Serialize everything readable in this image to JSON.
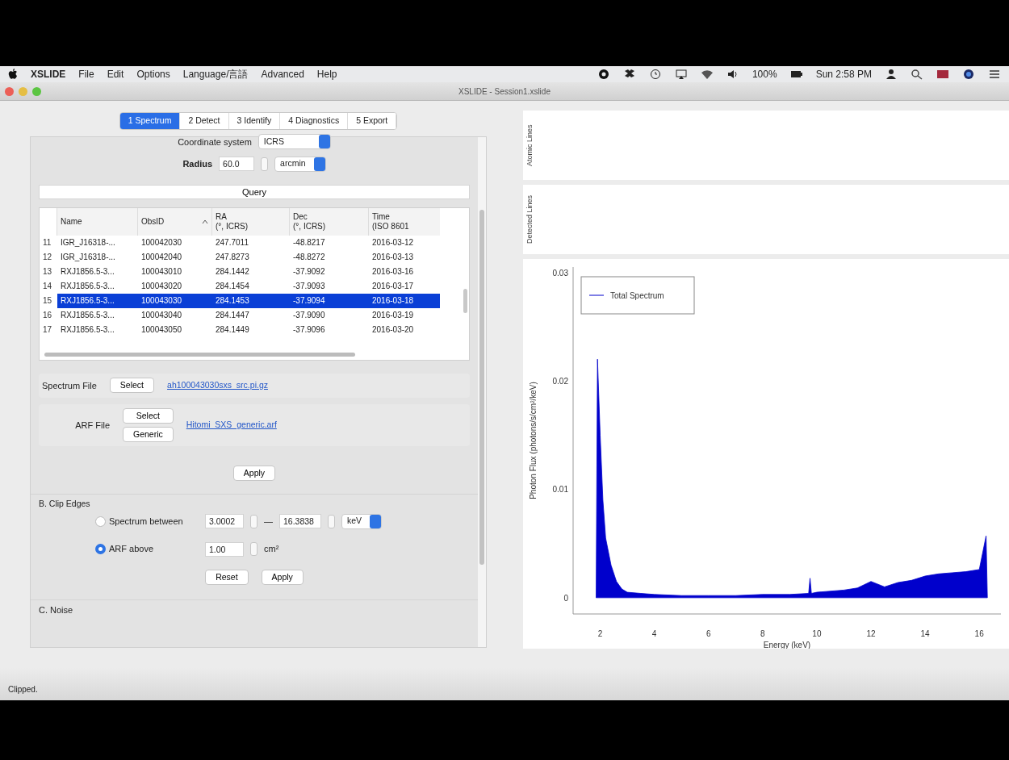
{
  "menubar": {
    "app": "XSLIDE",
    "menus": [
      "File",
      "Edit",
      "Options",
      "Language/言語",
      "Advanced",
      "Help"
    ],
    "battery": "100%",
    "clock": "Sun 2:58 PM"
  },
  "window": {
    "title": "XSLIDE - Session1.xslide"
  },
  "tabs": [
    {
      "label": "1 Spectrum",
      "selected": true
    },
    {
      "label": "2 Detect",
      "selected": false
    },
    {
      "label": "3 Identify",
      "selected": false
    },
    {
      "label": "4 Diagnostics",
      "selected": false
    },
    {
      "label": "5 Export",
      "selected": false
    }
  ],
  "query": {
    "coord_label": "Coordinate system",
    "coord_value": "ICRS",
    "radius_label": "Radius",
    "radius_value": "60.0",
    "radius_unit": "arcmin",
    "button": "Query"
  },
  "table": {
    "columns": [
      {
        "title": "Name",
        "sorted": false
      },
      {
        "title": "ObsID",
        "sorted": true
      },
      {
        "title": "RA",
        "subtitle": "(°, ICRS)",
        "sorted": false
      },
      {
        "title": "Dec",
        "subtitle": "(°, ICRS)",
        "sorted": false
      },
      {
        "title": "Time",
        "subtitle": "(ISO 8601",
        "sorted": false
      }
    ],
    "rows": [
      {
        "index": "11",
        "cells": [
          "IGR_J16318-...",
          "100042030",
          "247.7011",
          "-48.8217",
          "2016-03-12"
        ],
        "selected": false
      },
      {
        "index": "12",
        "cells": [
          "IGR_J16318-...",
          "100042040",
          "247.8273",
          "-48.8272",
          "2016-03-13"
        ],
        "selected": false
      },
      {
        "index": "13",
        "cells": [
          "RXJ1856.5-3...",
          "100043010",
          "284.1442",
          "-37.9092",
          "2016-03-16"
        ],
        "selected": false
      },
      {
        "index": "14",
        "cells": [
          "RXJ1856.5-3...",
          "100043020",
          "284.1454",
          "-37.9093",
          "2016-03-17"
        ],
        "selected": false
      },
      {
        "index": "15",
        "cells": [
          "RXJ1856.5-3...",
          "100043030",
          "284.1453",
          "-37.9094",
          "2016-03-18"
        ],
        "selected": true
      },
      {
        "index": "16",
        "cells": [
          "RXJ1856.5-3...",
          "100043040",
          "284.1447",
          "-37.9090",
          "2016-03-19"
        ],
        "selected": false
      },
      {
        "index": "17",
        "cells": [
          "RXJ1856.5-3...",
          "100043050",
          "284.1449",
          "-37.9096",
          "2016-03-20"
        ],
        "selected": false
      }
    ]
  },
  "files": {
    "spectrum_label": "Spectrum File",
    "spectrum_button": "Select",
    "spectrum_file": "ah100043030sxs_src.pi.gz",
    "arf_label": "ARF File",
    "arf_buttons": [
      "Select",
      "Generic"
    ],
    "arf_file": "Hitomi_SXS_generic.arf",
    "apply": "Apply"
  },
  "clip": {
    "title": "B. Clip Edges",
    "options": [
      {
        "label": "Spectrum between",
        "selected": false
      },
      {
        "label": "ARF above",
        "selected": true
      }
    ],
    "low": "3.0002",
    "dash": "—",
    "high": "16.3838",
    "unit": "keV",
    "arf_value": "1.00",
    "arf_unit": "cm²",
    "buttons": [
      "Reset",
      "Apply"
    ]
  },
  "noise": {
    "title": "C. Noise"
  },
  "plots": {
    "atomic_label": "Atomic Lines",
    "detected_label": "Detected Lines",
    "spectrum": {
      "chart_data": {
        "type": "area",
        "xlabel": "Energy (keV)",
        "ylabel": "Photon Flux (photons/s/cm²/keV)",
        "x": [
          1.85,
          1.9,
          2.0,
          2.1,
          2.2,
          2.4,
          2.6,
          2.8,
          3.0,
          3.5,
          4.0,
          5.0,
          6.0,
          7.0,
          8.0,
          9.0,
          9.7,
          9.75,
          9.8,
          10.0,
          11.0,
          11.5,
          12.0,
          12.5,
          13.0,
          13.5,
          14.0,
          14.5,
          15.0,
          15.5,
          16.0,
          16.25,
          16.3
        ],
        "series": [
          {
            "name": "Total Spectrum",
            "color": "#0000cc",
            "values": [
              0,
              0.022,
              0.015,
              0.009,
              0.0055,
              0.003,
              0.0015,
              0.0008,
              0.0005,
              0.0004,
              0.0003,
              0.0002,
              0.0002,
              0.0002,
              0.0003,
              0.0003,
              0.0004,
              0.0018,
              0.0004,
              0.0005,
              0.0007,
              0.0009,
              0.0015,
              0.001,
              0.0014,
              0.0016,
              0.002,
              0.0022,
              0.0023,
              0.0024,
              0.0026,
              0.0057,
              0
            ]
          }
        ],
        "xlim": [
          1,
          16.8
        ],
        "ylim": [
          -0.0015,
          0.0305
        ],
        "xticks": [
          2,
          4,
          6,
          8,
          10,
          12,
          14,
          16
        ],
        "yticks": [
          0,
          0.01,
          0.02,
          0.03
        ]
      }
    }
  },
  "status_bar": "Clipped."
}
